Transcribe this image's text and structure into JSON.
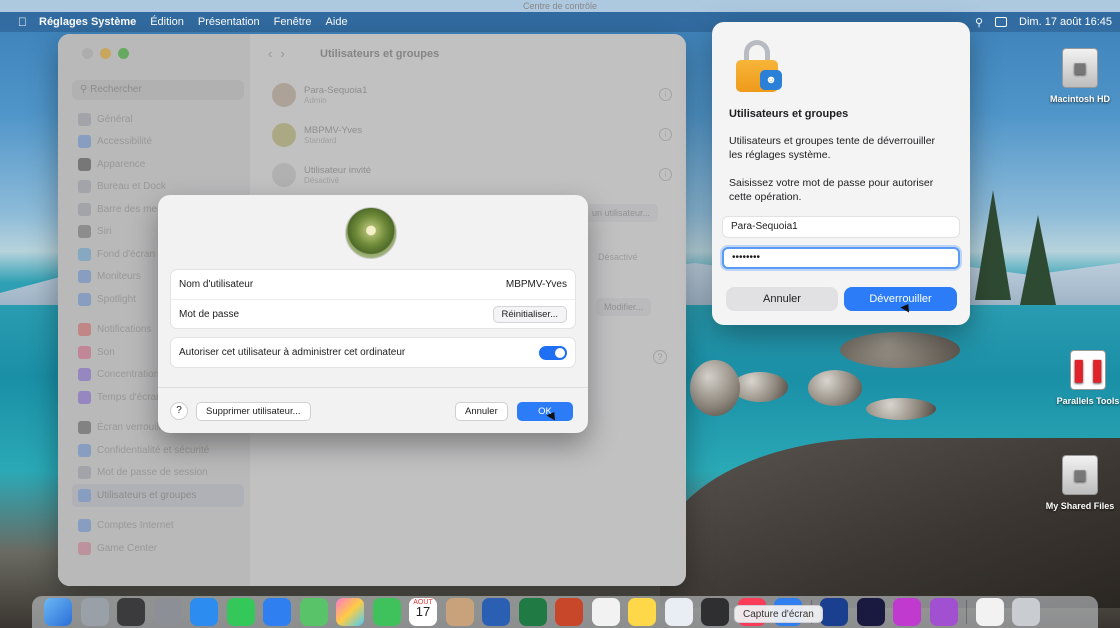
{
  "menubar": {
    "ghost_title": "Centre de contrôle",
    "app_name": "Réglages Système",
    "items": [
      "Édition",
      "Présentation",
      "Fenêtre",
      "Aide"
    ],
    "clock": "Dim. 17 août  16:45"
  },
  "desktop_icons": [
    "Macintosh HD",
    "Parallels Tools",
    "My Shared Files"
  ],
  "settings": {
    "search_placeholder": "Rechercher",
    "sidebar": [
      "Général",
      "Accessibilité",
      "Apparence",
      "Bureau et Dock",
      "Barre des menus",
      "Siri",
      "Fond d'écran",
      "Moniteurs",
      "Spotlight",
      "Notifications",
      "Son",
      "Concentration",
      "Temps d'écran",
      "Écran verrouillé",
      "Confidentialité et sécurité",
      "Mot de passe de session",
      "Utilisateurs et groupes",
      "Comptes Internet",
      "Game Center"
    ],
    "title": "Utilisateurs et groupes",
    "users": [
      {
        "name": "Para-Sequoia1",
        "role": "Admin"
      },
      {
        "name": "MBPMV-Yves",
        "role": "Standard"
      },
      {
        "name": "Utilisateur invité",
        "role": "Désactivé"
      }
    ],
    "add_user_button": "un utilisateur...",
    "disabled_label": "Désactivé",
    "modify_button": "Modifier...",
    "help": "?"
  },
  "user_sheet": {
    "username_label": "Nom d'utilisateur",
    "username_value": "MBPMV-Yves",
    "password_label": "Mot de passe",
    "reset_button": "Réinitialiser...",
    "admin_label": "Autoriser cet utilisateur à administrer cet ordinateur",
    "admin_enabled": true,
    "help": "?",
    "delete_button": "Supprimer utilisateur...",
    "cancel_button": "Annuler",
    "ok_button": "OK"
  },
  "auth_dialog": {
    "title": "Utilisateurs et groupes",
    "message": "Utilisateurs et groupes tente de déverrouiller les réglages système.",
    "prompt": "Saisissez votre mot de passe pour autoriser cette opération.",
    "username_value": "Para-Sequoia1",
    "password_value": "••••••••",
    "cancel_button": "Annuler",
    "unlock_button": "Déverrouiller"
  },
  "dock": {
    "tooltip": "Capture d'écran",
    "calendar_month": "AOÛT",
    "calendar_day": "17"
  },
  "colors": {
    "accent": "#2b7cf6",
    "lock_body": "#f0a020"
  }
}
